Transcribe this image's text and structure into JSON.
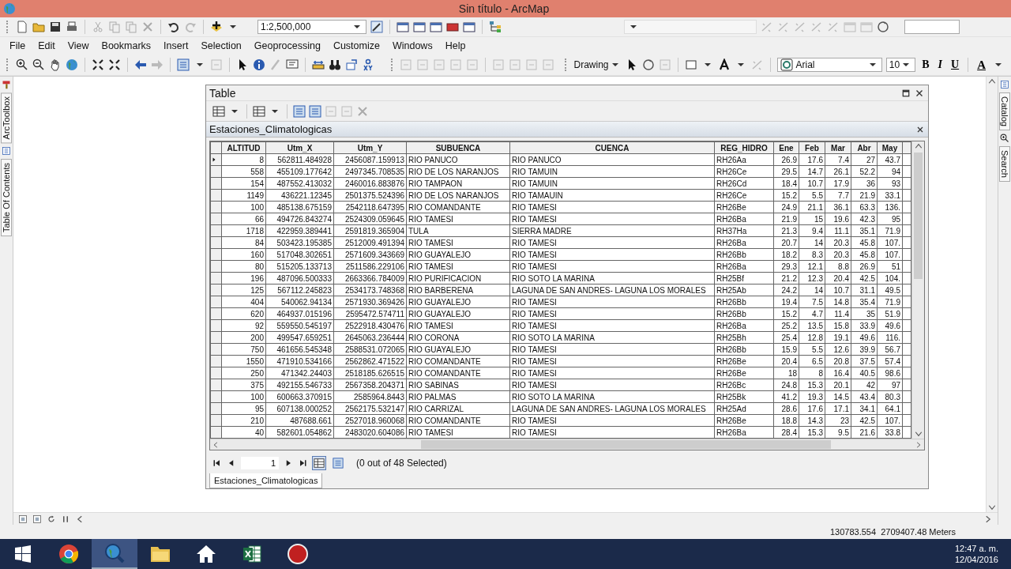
{
  "window": {
    "title": "Sin título - ArcMap"
  },
  "standard_toolbar": {
    "scale": "1:2,500,000"
  },
  "menu": [
    "File",
    "Edit",
    "View",
    "Bookmarks",
    "Insert",
    "Selection",
    "Geoprocessing",
    "Customize",
    "Windows",
    "Help"
  ],
  "drawing_toolbar": {
    "drawing": "Drawing",
    "font": "Arial",
    "size": "10",
    "bold": "B",
    "italic": "I",
    "underline": "U",
    "font_color": "A"
  },
  "dock_left": [
    "ArcToolbox",
    "Table Of Contents"
  ],
  "dock_right": [
    "Catalog",
    "Search"
  ],
  "table_window": {
    "title": "Table",
    "table_name": "Estaciones_Climatologicas",
    "columns": [
      {
        "label": "ALTITUD",
        "kind": "number"
      },
      {
        "label": "Utm_X",
        "kind": "number"
      },
      {
        "label": "Utm_Y",
        "kind": "number"
      },
      {
        "label": "SUBUENCA",
        "kind": "text"
      },
      {
        "label": "CUENCA",
        "kind": "text"
      },
      {
        "label": "REG_HIDRO",
        "kind": "text"
      },
      {
        "label": "Ene",
        "kind": "number"
      },
      {
        "label": "Feb",
        "kind": "number"
      },
      {
        "label": "Mar",
        "kind": "number"
      },
      {
        "label": "Abr",
        "kind": "number"
      },
      {
        "label": "May",
        "kind": "number"
      }
    ],
    "rows": [
      {
        "current": true,
        "cells": [
          "8",
          "562811.484928",
          "2456087.159913",
          "RIO PANUCO",
          "RIO PANUCO",
          "RH26Aa",
          "26.9",
          "17.6",
          "7.4",
          "27",
          "43.7"
        ]
      },
      {
        "current": false,
        "cells": [
          "558",
          "455109.177642",
          "2497345.708535",
          "RIO DE LOS NARANJOS",
          "RIO TAMUIN",
          "RH26Ce",
          "29.5",
          "14.7",
          "26.1",
          "52.2",
          "94"
        ]
      },
      {
        "current": false,
        "cells": [
          "154",
          "487552.413032",
          "2460016.883876",
          "RIO TAMPAON",
          "RIO TAMUIN",
          "RH26Cd",
          "18.4",
          "10.7",
          "17.9",
          "36",
          "93"
        ]
      },
      {
        "current": false,
        "cells": [
          "1149",
          "436221.12345",
          "2501375.524396",
          "RIO DE LOS NARANJOS",
          "RIO TAMAUIN",
          "RH26Ce",
          "15.2",
          "5.5",
          "7.7",
          "21.9",
          "33.1"
        ]
      },
      {
        "current": false,
        "cells": [
          "100",
          "485138.675159",
          "2542118.647395",
          "RIO COMANDANTE",
          "RIO TAMESI",
          "RH26Be",
          "24.9",
          "21.1",
          "36.1",
          "63.3",
          "136."
        ]
      },
      {
        "current": false,
        "cells": [
          "66",
          "494726.843274",
          "2524309.059645",
          "RIO TAMESI",
          "RIO TAMESI",
          "RH26Ba",
          "21.9",
          "15",
          "19.6",
          "42.3",
          "95"
        ]
      },
      {
        "current": false,
        "cells": [
          "1718",
          "422959.389441",
          "2591819.365904",
          "TULA",
          "SIERRA MADRE",
          "RH37Ha",
          "21.3",
          "9.4",
          "11.1",
          "35.1",
          "71.9"
        ]
      },
      {
        "current": false,
        "cells": [
          "84",
          "503423.195385",
          "2512009.491394",
          "RIO TAMESI",
          "RIO TAMESI",
          "RH26Ba",
          "20.7",
          "14",
          "20.3",
          "45.8",
          "107."
        ]
      },
      {
        "current": false,
        "cells": [
          "160",
          "517048.302651",
          "2571609.343669",
          "RIO GUAYALEJO",
          "RIO TAMESI",
          "RH26Bb",
          "18.2",
          "8.3",
          "20.3",
          "45.8",
          "107."
        ]
      },
      {
        "current": false,
        "cells": [
          "80",
          "515205.133713",
          "2511586.229106",
          "RIO TAMESI",
          "RIO TAMESI",
          "RH26Ba",
          "29.3",
          "12.1",
          "8.8",
          "26.9",
          "51"
        ]
      },
      {
        "current": false,
        "cells": [
          "196",
          "487096.500333",
          "2663366.784009",
          "RIO PURIFICACION",
          "RIO SOTO LA MARINA",
          "RH25Bf",
          "21.2",
          "12.3",
          "20.4",
          "42.5",
          "104."
        ]
      },
      {
        "current": false,
        "cells": [
          "125",
          "567112.245823",
          "2534173.748368",
          "RIO BARBERENA",
          "LAGUNA DE SAN ANDRES- LAGUNA LOS MORALES",
          "RH25Ab",
          "24.2",
          "14",
          "10.7",
          "31.1",
          "49.5"
        ]
      },
      {
        "current": false,
        "cells": [
          "404",
          "540062.94134",
          "2571930.369426",
          "RIO GUAYALEJO",
          "RIO TAMESI",
          "RH26Bb",
          "19.4",
          "7.5",
          "14.8",
          "35.4",
          "71.9"
        ]
      },
      {
        "current": false,
        "cells": [
          "620",
          "464937.015196",
          "2595472.574711",
          "RIO GUAYALEJO",
          "RIO TAMESI",
          "RH26Bb",
          "15.2",
          "4.7",
          "11.4",
          "35",
          "51.9"
        ]
      },
      {
        "current": false,
        "cells": [
          "92",
          "559550.545197",
          "2522918.430476",
          "RIO TAMESI",
          "RIO TAMESI",
          "RH26Ba",
          "25.2",
          "13.5",
          "15.8",
          "33.9",
          "49.6"
        ]
      },
      {
        "current": false,
        "cells": [
          "200",
          "499547.659251",
          "2645063.236444",
          "RIO CORONA",
          "RIO SOTO LA MARINA",
          "RH25Bh",
          "25.4",
          "12.8",
          "19.1",
          "49.6",
          "116."
        ]
      },
      {
        "current": false,
        "cells": [
          "750",
          "461656.545348",
          "2588531.072065",
          "RIO GUAYALEJO",
          "RIO TAMESI",
          "RH26Bb",
          "15.9",
          "5.5",
          "12.6",
          "39.9",
          "56.7"
        ]
      },
      {
        "current": false,
        "cells": [
          "1550",
          "471910.534166",
          "2562862.471522",
          "RIO COMANDANTE",
          "RIO TAMESI",
          "RH26Be",
          "20.4",
          "6.5",
          "20.8",
          "37.5",
          "57.4"
        ]
      },
      {
        "current": false,
        "cells": [
          "250",
          "471342.24403",
          "2518185.626515",
          "RIO COMANDANTE",
          "RIO TAMESI",
          "RH26Be",
          "18",
          "8",
          "16.4",
          "40.5",
          "98.6"
        ]
      },
      {
        "current": false,
        "cells": [
          "375",
          "492155.546733",
          "2567358.204371",
          "RIO SABINAS",
          "RIO TAMESI",
          "RH26Bc",
          "24.8",
          "15.3",
          "20.1",
          "42",
          "97"
        ]
      },
      {
        "current": false,
        "cells": [
          "100",
          "600663.370915",
          "2585964.8443",
          "RIO PALMAS",
          "RIO SOTO LA MARINA",
          "RH25Bk",
          "41.2",
          "19.3",
          "14.5",
          "43.4",
          "80.3"
        ]
      },
      {
        "current": false,
        "cells": [
          "95",
          "607138.000252",
          "2562175.532147",
          "RIO CARRIZAL",
          "LAGUNA DE SAN ANDRES- LAGUNA LOS MORALES",
          "RH25Ad",
          "28.6",
          "17.6",
          "17.1",
          "34.1",
          "64.1"
        ]
      },
      {
        "current": false,
        "cells": [
          "210",
          "487688.661",
          "2527018.960068",
          "RIO COMANDANTE",
          "RIO TAMESI",
          "RH26Be",
          "18.8",
          "14.3",
          "23",
          "42.5",
          "107."
        ]
      },
      {
        "current": false,
        "cells": [
          "40",
          "582601.054862",
          "2483020.604086",
          "RIO TAMESI",
          "RIO TAMESI",
          "RH26Ba",
          "28.4",
          "15.3",
          "9.5",
          "21.6",
          "33.8"
        ]
      }
    ],
    "record": "1",
    "views": [
      {
        "selected": true
      },
      {
        "selected": false
      }
    ],
    "selection_status": "(0 out of 48 Selected)",
    "tabs": [
      {
        "label": "Estaciones_Climatologicas",
        "selected": true
      }
    ]
  },
  "status_bar": {
    "coordinates": "130783.554  2709407.48 Meters"
  },
  "taskbar": {
    "apps": [
      {
        "kind": "chrome",
        "selected": false
      },
      {
        "kind": "arcmap",
        "selected": true
      },
      {
        "kind": "folder",
        "selected": false
      },
      {
        "kind": "home",
        "selected": false
      },
      {
        "kind": "excel",
        "selected": false
      },
      {
        "kind": "record",
        "selected": false
      }
    ],
    "time": "12:47 a. m.",
    "date": "12/04/2016"
  }
}
